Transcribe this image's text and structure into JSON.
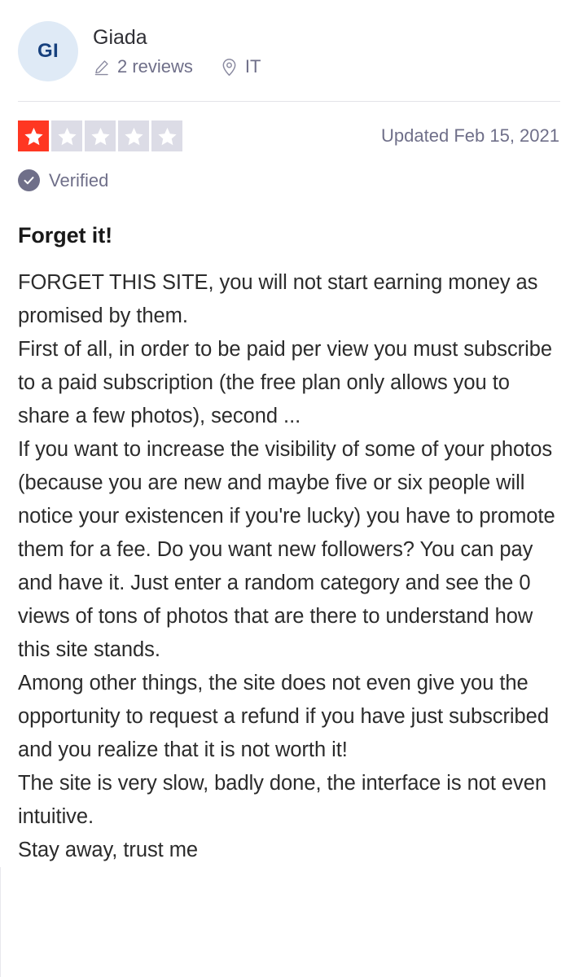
{
  "review_card": {
    "consumer": {
      "avatar_initials": "GI",
      "avatar_bg_color": "#dfeaf6",
      "avatar_text_color": "#17417e",
      "name": "Giada",
      "meta": [
        {
          "icon": "pencil-icon",
          "label": "2 reviews"
        },
        {
          "icon": "location-pin-icon",
          "label": "IT"
        }
      ]
    },
    "rating": {
      "value": 1,
      "max": 5,
      "filled_color": "#ff3722",
      "empty_color": "#dcdce6",
      "star_glyph_color": "#ffffff"
    },
    "date_label": "Updated Feb 15, 2021",
    "verified": {
      "label": "Verified",
      "icon": "check-circle-icon",
      "color": "#6f6f89"
    },
    "title": "Forget it!",
    "body": "FORGET THIS SITE, you will not start earning money as promised by them.\nFirst of all, in order to be paid per view you must subscribe to a paid subscription (the free plan only allows you to share a few photos), second ...\nIf you want to increase the visibility of some of your photos (because you are new and maybe five or six people will notice your existencen if you're lucky) you have to promote them for a fee. Do you want new followers? You can pay and have it. Just enter a random category and see the 0 views of tons of photos that are there to understand how this site stands.\nAmong other things, the site does not even give you the opportunity to request a refund if you have just subscribed and you realize that it is not worth it!\nThe site is very slow, badly done, the interface is not even intuitive.\nStay away, trust me"
  }
}
